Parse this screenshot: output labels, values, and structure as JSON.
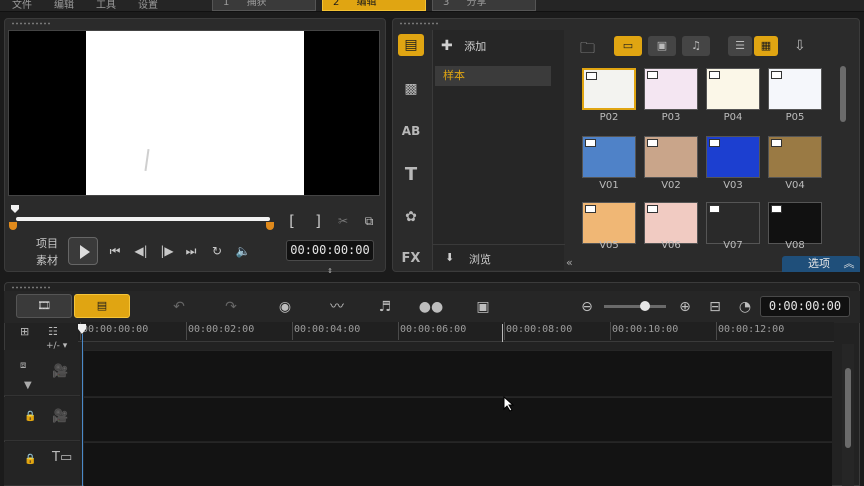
{
  "menu": [
    "文件",
    "编辑",
    "工具",
    "设置"
  ],
  "steps": [
    {
      "num": "1",
      "label": "捕获"
    },
    {
      "num": "2",
      "label": "编辑"
    },
    {
      "num": "3",
      "label": "分享"
    }
  ],
  "preview": {
    "mode_project": "项目",
    "mode_clip": "素材",
    "timecode": "00:00:00:00",
    "mark_in": "[",
    "mark_out": "]"
  },
  "library": {
    "add_label": "添加",
    "selected_folder": "样本",
    "browse_label": "浏览",
    "options_label": "选项",
    "side_icons": [
      "media-icon",
      "transition-icon",
      "title-ab-icon",
      "text-icon",
      "graphic-icon",
      "fx-icon"
    ],
    "fx_text": "FX",
    "ab_text": "AB",
    "t_text": "T",
    "thumbnails": [
      {
        "label": "P02",
        "color": "#f3f3f0",
        "selected": true
      },
      {
        "label": "P03",
        "color": "#f4e6f2",
        "selected": false
      },
      {
        "label": "P04",
        "color": "#fbf7e8",
        "selected": false
      },
      {
        "label": "P05",
        "color": "#f5f7fb",
        "selected": false
      },
      {
        "label": "V01",
        "color": "#4f82c8",
        "selected": false
      },
      {
        "label": "V02",
        "color": "#c9a58a",
        "selected": false
      },
      {
        "label": "V03",
        "color": "#1c3fd0",
        "selected": false
      },
      {
        "label": "V04",
        "color": "#9a7a44",
        "selected": false
      },
      {
        "label": "V05",
        "color": "#f0b775",
        "selected": false
      },
      {
        "label": "V06",
        "color": "#f1cbc2",
        "selected": false
      },
      {
        "label": "V07",
        "color": "#2a2a2a",
        "selected": false
      },
      {
        "label": "V08",
        "color": "#111111",
        "selected": false
      }
    ]
  },
  "timeline": {
    "timecode": "0:00:00:00",
    "track_add": "+/-",
    "ruler": [
      "00:00:00:00",
      "00:00:02:00",
      "00:00:04:00",
      "00:00:06:00",
      "00:00:08:00",
      "00:00:10:00",
      "00:00:12:00"
    ]
  },
  "colors": {
    "accent": "#e0a512",
    "bg": "#1b1b1b",
    "panel": "#2b2b2b"
  }
}
